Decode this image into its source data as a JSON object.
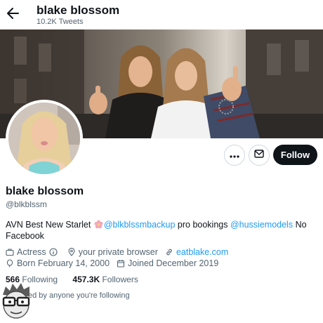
{
  "header": {
    "name": "blake blossom",
    "tweet_count": "10.2K Tweets"
  },
  "profile": {
    "display_name": "blake blossom",
    "handle": "@blkblssm",
    "bio": {
      "part1": "AVN Best New Starlet ",
      "link1": "@blkblssmbackup",
      "part2": " pro bookings ",
      "link2": "@hussiemodels",
      "part3": " No Facebook"
    },
    "category": "Actress",
    "location": "your private browser",
    "website": "eatblake.com",
    "born": "Born February 14, 2000",
    "joined": "Joined December 2019"
  },
  "stats": {
    "following_count": "566",
    "following_label": "Following",
    "followers_count": "457.3K",
    "followers_label": "Followers"
  },
  "followed_by": "ed by anyone you're following",
  "buttons": {
    "follow": "Follow"
  },
  "icons": [
    "back-arrow-icon",
    "more-icon",
    "mail-icon",
    "briefcase-icon",
    "info-icon",
    "location-icon",
    "link-icon",
    "balloon-icon",
    "calendar-icon",
    "flower-icon"
  ],
  "colors": {
    "accent": "#1d9bf0",
    "text": "#0f1419",
    "muted": "#536471",
    "follow_bg": "#0f1419"
  }
}
